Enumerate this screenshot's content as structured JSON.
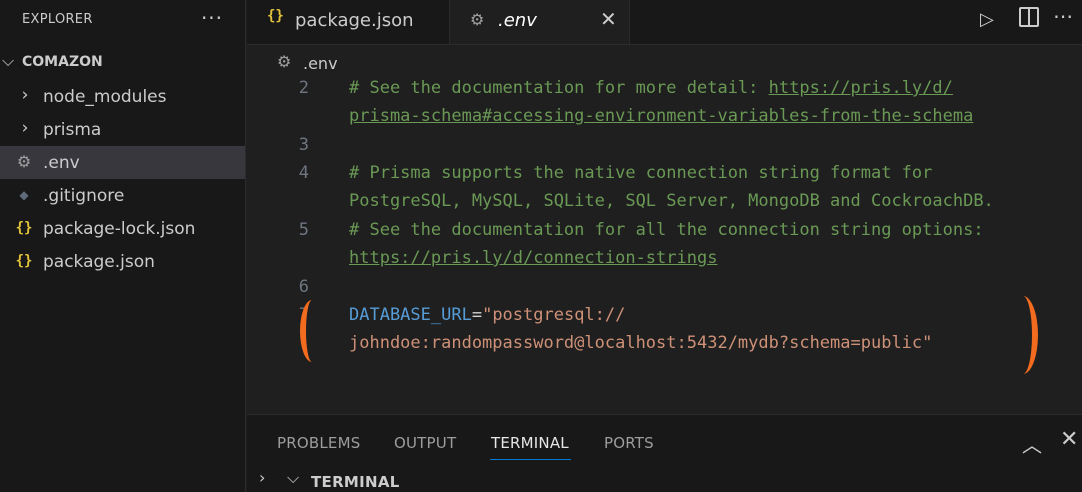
{
  "sidebar": {
    "title": "EXPLORER",
    "more": "···",
    "folder": "COMAZON",
    "items": [
      {
        "label": "node_modules",
        "icon": "chevron-right-icon"
      },
      {
        "label": "prisma",
        "icon": "chevron-right-icon"
      },
      {
        "label": ".env",
        "icon": "gear-icon",
        "active": true
      },
      {
        "label": ".gitignore",
        "icon": "git-icon"
      },
      {
        "label": "package-lock.json",
        "icon": "json-braces-icon"
      },
      {
        "label": "package.json",
        "icon": "json-braces-icon"
      }
    ]
  },
  "tabs": [
    {
      "label": "package.json",
      "icon": "json-braces-icon"
    },
    {
      "label": ".env",
      "icon": "gear-icon",
      "active": true,
      "close": "✕"
    }
  ],
  "breadcrumb": {
    "file": ".env"
  },
  "editor": {
    "lines": [
      {
        "num": "2",
        "c1": "# See the documentation for more detail: ",
        "link1": "https://pris.ly/d/",
        "link2": "prisma-schema#accessing-environment-variables-from-the-schema"
      },
      {
        "num": "3"
      },
      {
        "num": "4",
        "c1": "# Prisma supports the native connection string format for",
        "c2": "PostgreSQL, MySQL, SQLite, SQL Server, MongoDB and CockroachDB."
      },
      {
        "num": "5",
        "c1": "# See the documentation for all the connection string options:",
        "link2": "https://pris.ly/d/connection-strings"
      },
      {
        "num": "6"
      },
      {
        "num": "7",
        "var": "DATABASE_URL",
        "eq": "=",
        "str1": "\"postgresql://",
        "str2": "johndoe:randompassword@localhost:5432/mydb?schema=public\""
      }
    ]
  },
  "panel": {
    "tabs": [
      "PROBLEMS",
      "OUTPUT",
      "TERMINAL",
      "PORTS"
    ],
    "active": "TERMINAL",
    "section": "TERMINAL"
  },
  "colors": {
    "accent": "#0078d4",
    "annotation": "#f26b1f",
    "json_icon": "#e2c33b"
  }
}
